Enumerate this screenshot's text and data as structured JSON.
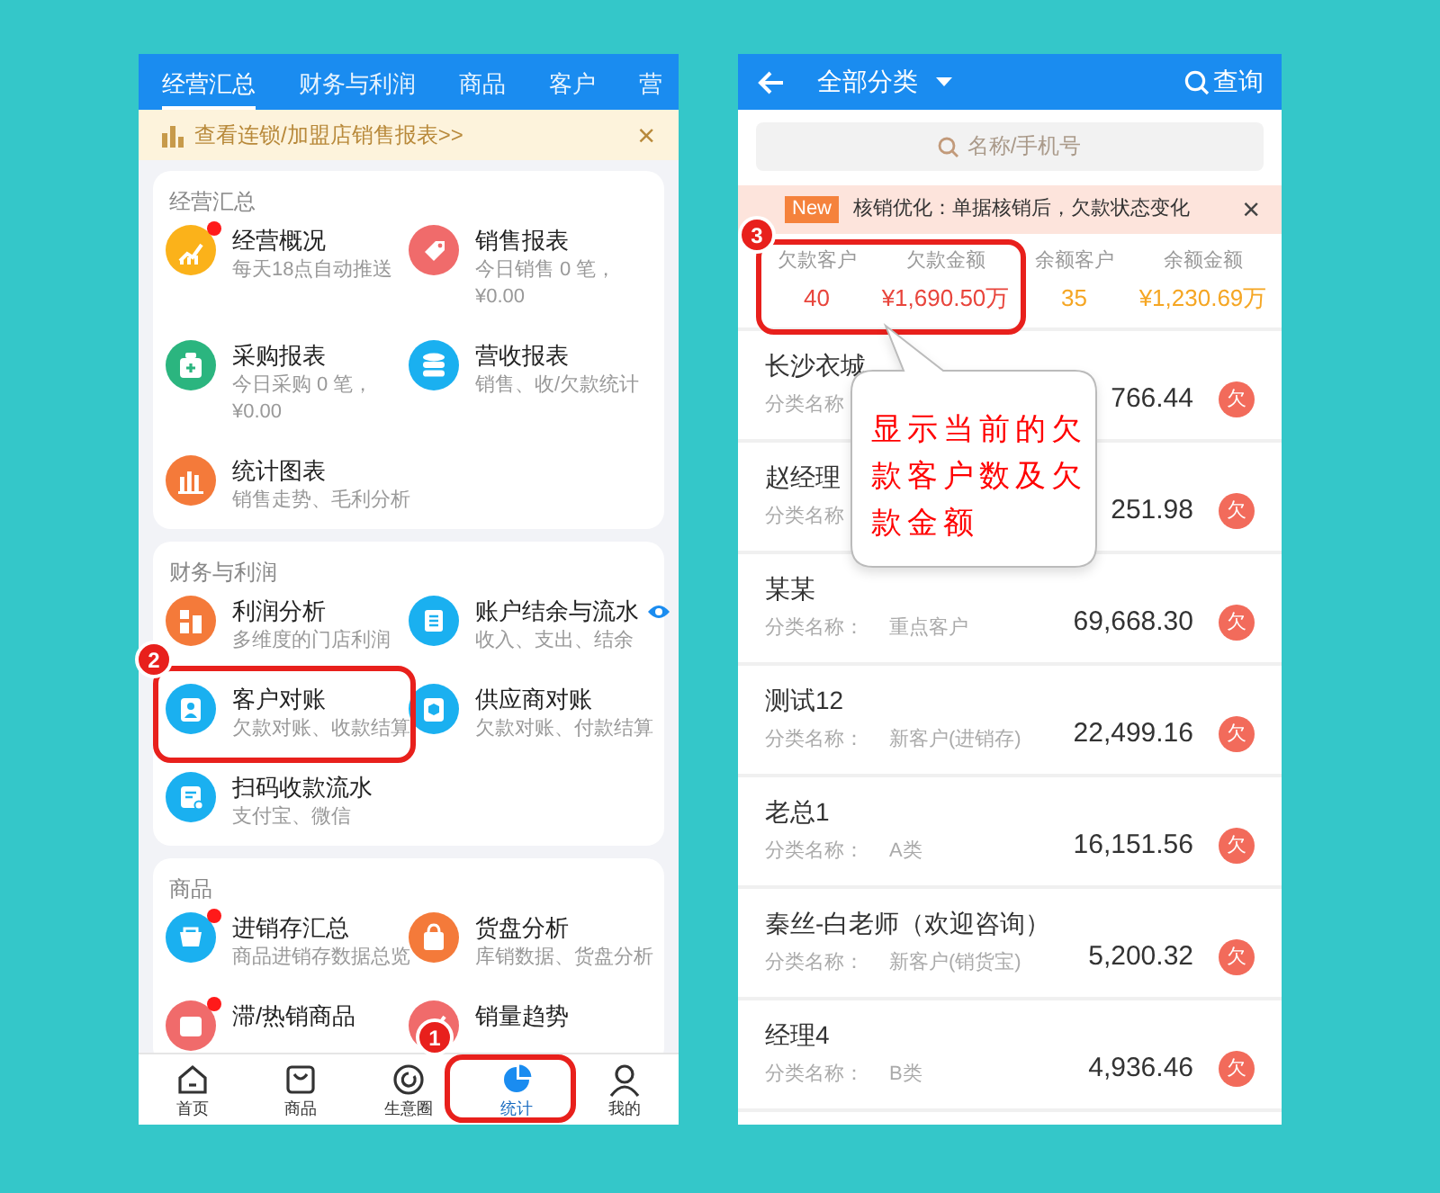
{
  "left_screen": {
    "tabs": [
      {
        "label": "经营汇总",
        "selected": true
      },
      {
        "label": "财务与利润",
        "selected": false
      },
      {
        "label": "商品",
        "selected": false
      },
      {
        "label": "客户",
        "selected": false
      },
      {
        "label": "营",
        "selected": false
      }
    ],
    "banner": {
      "text": "查看连锁/加盟店销售报表>>",
      "close": "×"
    },
    "sections": [
      {
        "title": "经营汇总",
        "items": [
          {
            "title": "经营概况",
            "sub": [
              "每天18点自动推送"
            ],
            "color": "#fbb21a",
            "dot": true,
            "eye": false
          },
          {
            "title": "销售报表",
            "sub": [
              "今日销售 0 笔，",
              "¥0.00"
            ],
            "color": "#f06b6b",
            "dot": false,
            "eye": false
          },
          {
            "title": "采购报表",
            "sub": [
              "今日采购 0 笔，",
              "¥0.00"
            ],
            "color": "#2bb57f",
            "dot": false,
            "eye": false
          },
          {
            "title": "营收报表",
            "sub": [
              "销售、收/欠款统计"
            ],
            "color": "#1ab0f0",
            "dot": false,
            "eye": false
          },
          {
            "title": "统计图表",
            "sub": [
              "销售走势、毛利分析"
            ],
            "color": "#f47a3a",
            "dot": false,
            "eye": false
          }
        ]
      },
      {
        "title": "财务与利润",
        "items": [
          {
            "title": "利润分析",
            "sub": [
              "多维度的门店利润"
            ],
            "color": "#f47a3a",
            "dot": false,
            "eye": false
          },
          {
            "title": "账户结余与流水",
            "sub": [
              "收入、支出、结余"
            ],
            "color": "#1ab0f0",
            "dot": false,
            "eye": true
          },
          {
            "title": "客户对账",
            "sub": [
              "欠款对账、收款结算"
            ],
            "color": "#1ab0f0",
            "dot": false,
            "eye": false
          },
          {
            "title": "供应商对账",
            "sub": [
              "欠款对账、付款结算"
            ],
            "color": "#1ab0f0",
            "dot": false,
            "eye": false
          },
          {
            "title": "扫码收款流水",
            "sub": [
              "支付宝、微信"
            ],
            "color": "#1ab0f0",
            "dot": false,
            "eye": false
          }
        ]
      },
      {
        "title": "商品",
        "items": [
          {
            "title": "进销存汇总",
            "sub": [
              "商品进销存数据总览"
            ],
            "color": "#1ab0f0",
            "dot": true,
            "eye": false
          },
          {
            "title": "货盘分析",
            "sub": [
              "库销数据、货盘分析"
            ],
            "color": "#f47a3a",
            "dot": false,
            "eye": false
          },
          {
            "title": "滞/热销商品",
            "color": "#f06b6b",
            "dot": true,
            "eye": false
          },
          {
            "title": "销量趋势",
            "color": "#f06b6b",
            "dot": false,
            "eye": false
          }
        ]
      }
    ],
    "nav": [
      {
        "label": "首页",
        "selected": false
      },
      {
        "label": "商品",
        "selected": false
      },
      {
        "label": "生意圈",
        "selected": false
      },
      {
        "label": "统计",
        "selected": true
      },
      {
        "label": "我的",
        "selected": false
      }
    ]
  },
  "right_screen": {
    "header": {
      "title": "全部分类",
      "action": "查询"
    },
    "search": {
      "placeholder": "名称/手机号"
    },
    "notice": {
      "badge": "New",
      "text": "核销优化：单据核销后，欠款状态变化",
      "close": "×"
    },
    "stats": [
      {
        "label": "欠款客户",
        "value": "40",
        "color": "#e8453c"
      },
      {
        "label": "欠款金额",
        "value": "¥1,690.50万",
        "color": "#e8453c"
      },
      {
        "label": "余额客户",
        "value": "35",
        "color": "#f5a623"
      },
      {
        "label": "余额金额",
        "value": "¥1,230.69万",
        "color": "#f5a623"
      }
    ],
    "rows": [
      {
        "name": "长沙衣城",
        "category_label": "分类名称",
        "amount": "766.44",
        "badge": "欠"
      },
      {
        "name": "赵经理",
        "category_label": "分类名称",
        "amount": "251.98",
        "badge": "欠"
      },
      {
        "name": "某某",
        "category_label": "分类名称：",
        "category": "重点客户",
        "amount": "69,668.30",
        "badge": "欠"
      },
      {
        "name": "测试12",
        "category_label": "分类名称：",
        "category": "新客户(进销存)",
        "amount": "22,499.16",
        "badge": "欠"
      },
      {
        "name": "老总1",
        "category_label": "分类名称：",
        "category": "A类",
        "amount": "16,151.56",
        "badge": "欠"
      },
      {
        "name": "秦丝-白老师（欢迎咨询）",
        "category_label": "分类名称：",
        "category": "新客户(销货宝)",
        "amount": "5,200.32",
        "badge": "欠"
      },
      {
        "name": "经理4",
        "category_label": "分类名称：",
        "category": "B类",
        "amount": "4,936.46",
        "badge": "欠"
      }
    ]
  },
  "annotations": [
    {
      "number": "1"
    },
    {
      "number": "2"
    },
    {
      "number": "3"
    }
  ],
  "callout": {
    "text": "显示当前的欠款客户数及欠款金额"
  }
}
